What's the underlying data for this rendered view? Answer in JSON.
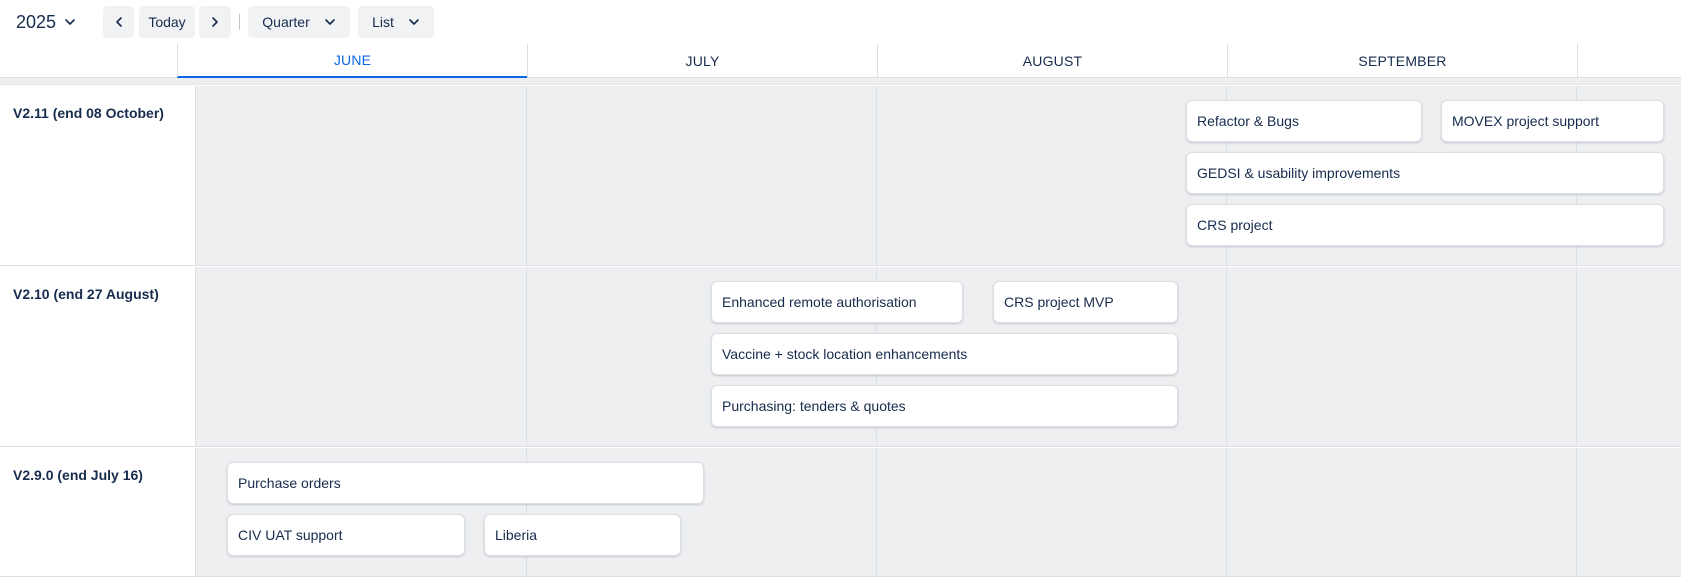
{
  "toolbar": {
    "year": "2025",
    "prev_icon": "chevron-left-icon",
    "today_label": "Today",
    "next_icon": "chevron-right-icon",
    "view_label": "Quarter",
    "mode_label": "List"
  },
  "months": [
    "JUNE",
    "JULY",
    "AUGUST",
    "SEPTEMBER"
  ],
  "active_month": "JUNE",
  "rows": [
    {
      "label": "V2.11 (end 08 October)",
      "items": [
        "Refactor & Bugs",
        "MOVEX project support",
        "GEDSI & usability improvements",
        "CRS project"
      ]
    },
    {
      "label": "V2.10 (end 27 August)",
      "items": [
        "Enhanced remote authorisation",
        "CRS project MVP",
        "Vaccine + stock location enhancements",
        "Purchasing: tenders & quotes"
      ]
    },
    {
      "label": "V2.9.0 (end July 16)",
      "items": [
        "Purchase orders",
        "CIV UAT support",
        "Liberia"
      ]
    }
  ],
  "colors": {
    "accent": "#0c66e4",
    "text": "#172b4d",
    "grid_bg": "#eeeff1",
    "button_bg": "#f1f2f4"
  }
}
